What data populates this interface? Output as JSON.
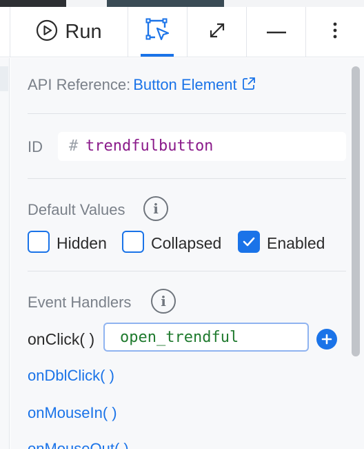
{
  "toolbar": {
    "run_label": "Run",
    "icons": [
      "play-circle-icon",
      "select-cursor-icon",
      "expand-icon",
      "minimize-icon",
      "more-vertical-icon"
    ],
    "active_tab": "select-cursor"
  },
  "api_reference": {
    "label": "API Reference:",
    "link_text": "Button Element",
    "icon": "external-link-icon"
  },
  "id_field": {
    "label": "ID",
    "prefix": "#",
    "value": "trendfulbutton"
  },
  "default_values": {
    "title": "Default Values",
    "options": [
      {
        "label": "Hidden",
        "checked": false
      },
      {
        "label": "Collapsed",
        "checked": false
      },
      {
        "label": "Enabled",
        "checked": true
      }
    ]
  },
  "event_handlers": {
    "title": "Event Handlers",
    "onclick": {
      "label": "onClick( )",
      "value": "open_trendful"
    },
    "links": [
      "onDblClick( )",
      "onMouseIn( )",
      "onMouseOut( )"
    ]
  },
  "colors": {
    "accent": "#1a73e8",
    "id_value": "#8a1a8a",
    "handler_value": "#1f7a2e",
    "muted_text": "#7a8089"
  }
}
